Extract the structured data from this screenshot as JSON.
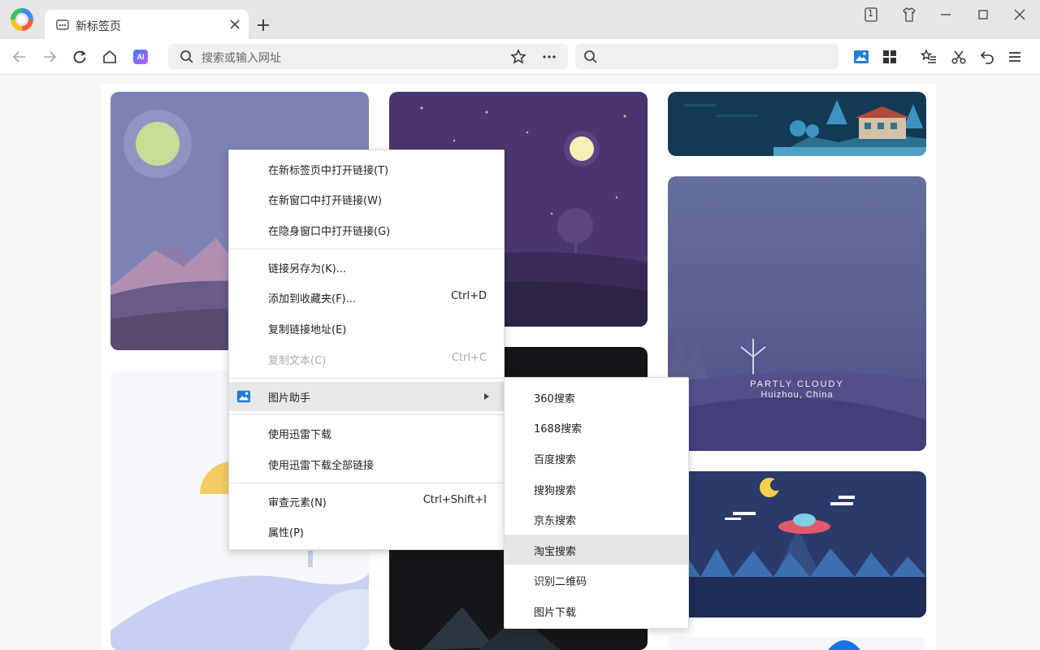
{
  "tab": {
    "title": "新标签页"
  },
  "window_controls": {
    "tab_count": "1"
  },
  "address_bar": {
    "placeholder": "搜索或输入网址"
  },
  "weather_card": {
    "condition": "PARTLY CLOUDY",
    "location": "Huizhou, China"
  },
  "context_menu": {
    "items": [
      {
        "label": "在新标签页中打开链接(T)",
        "shortcut": ""
      },
      {
        "label": "在新窗口中打开链接(W)",
        "shortcut": ""
      },
      {
        "label": "在隐身窗口中打开链接(G)",
        "shortcut": ""
      },
      {
        "label": "链接另存为(K)...",
        "shortcut": ""
      },
      {
        "label": "添加到收藏夹(F)...",
        "shortcut": "Ctrl+D"
      },
      {
        "label": "复制链接地址(E)",
        "shortcut": ""
      },
      {
        "label": "复制文本(C)",
        "shortcut": "Ctrl+C",
        "disabled": true
      },
      {
        "label": "图片助手",
        "shortcut": "",
        "has_submenu": true,
        "highlighted": true
      },
      {
        "label": "使用迅雷下载",
        "shortcut": ""
      },
      {
        "label": "使用迅雷下载全部链接",
        "shortcut": ""
      },
      {
        "label": "审查元素(N)",
        "shortcut": "Ctrl+Shift+I"
      },
      {
        "label": "属性(P)",
        "shortcut": ""
      }
    ]
  },
  "submenu": {
    "items": [
      {
        "label": "360搜索"
      },
      {
        "label": "1688搜索"
      },
      {
        "label": "百度搜索"
      },
      {
        "label": "搜狗搜索"
      },
      {
        "label": "京东搜索"
      },
      {
        "label": "淘宝搜索",
        "highlighted": true
      },
      {
        "label": "识别二维码"
      },
      {
        "label": "图片下载"
      }
    ]
  },
  "colors": {
    "titlebar": "#e6e6e6",
    "menu_highlight": "#e8e8e8",
    "accent_blue": "#1a73e8"
  }
}
